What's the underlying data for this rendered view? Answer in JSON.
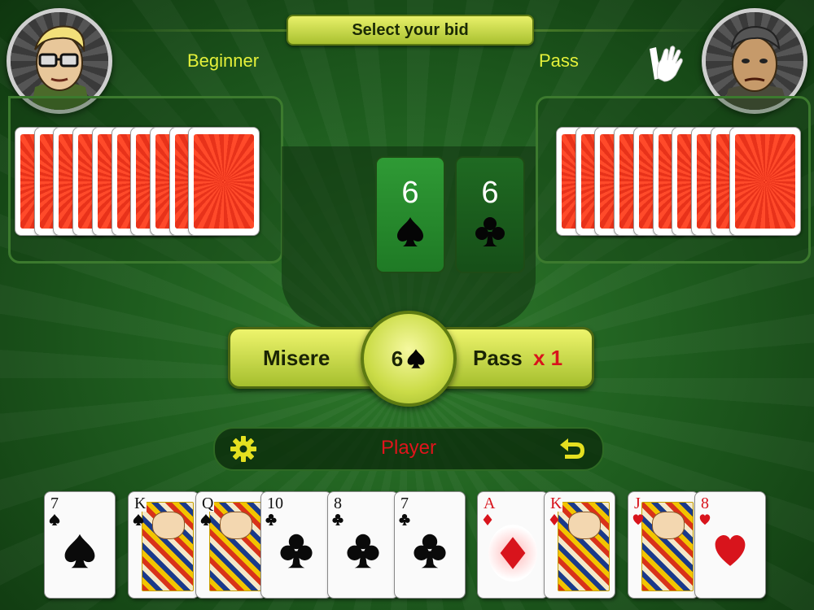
{
  "header": {
    "title": "Select your bid"
  },
  "players": {
    "left": {
      "name": "Beginner",
      "cards_count": 10
    },
    "right": {
      "name": "Pass",
      "cards_count": 10,
      "action_icon": "hand-pass-icon"
    }
  },
  "bids": [
    {
      "number": "6",
      "suit": "spades"
    },
    {
      "number": "6",
      "suit": "clubs"
    }
  ],
  "bid_bar": {
    "misere_label": "Misere",
    "current_bid_number": "6",
    "current_bid_suit": "spades",
    "pass_label": "Pass",
    "multiplier": "x 1"
  },
  "status_bar": {
    "player_label": "Player",
    "settings_icon": "gear-icon",
    "undo_icon": "undo-arrow-icon"
  },
  "hand": [
    {
      "rank": "7",
      "suit": "spades"
    },
    {
      "rank": "K",
      "suit": "spades"
    },
    {
      "rank": "Q",
      "suit": "spades"
    },
    {
      "rank": "10",
      "suit": "clubs"
    },
    {
      "rank": "8",
      "suit": "clubs"
    },
    {
      "rank": "7",
      "suit": "clubs"
    },
    {
      "rank": "A",
      "suit": "diamonds"
    },
    {
      "rank": "K",
      "suit": "diamonds"
    },
    {
      "rank": "J",
      "suit": "hearts"
    },
    {
      "rank": "8",
      "suit": "hearts"
    }
  ],
  "colors": {
    "accent": "#e4f03a",
    "table": "#1f5e1f",
    "player_label": "#e0141c"
  }
}
